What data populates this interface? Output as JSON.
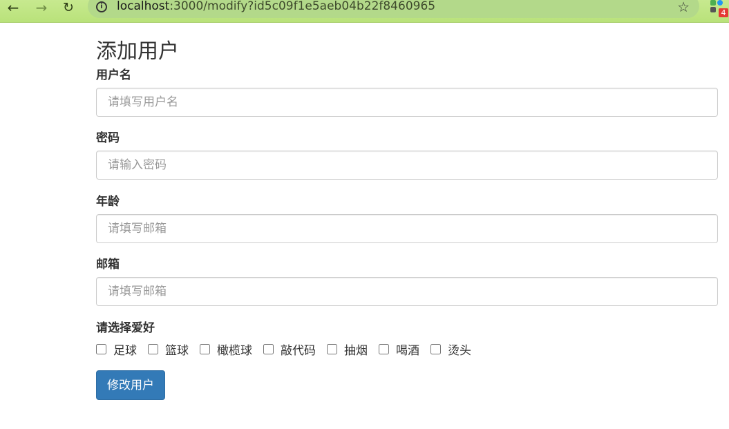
{
  "browser": {
    "url_host": "localhost",
    "url_rest": ":3000/modify?id5c09f1e5aeb04b22f8460965",
    "extension_badge": "4",
    "back_glyph": "←",
    "forward_glyph": "→",
    "reload_glyph": "↻",
    "star_glyph": "☆",
    "info_glyph": "i"
  },
  "page": {
    "title": "添加用户"
  },
  "form": {
    "username": {
      "label": "用户名",
      "placeholder": "请填写用户名",
      "value": ""
    },
    "password": {
      "label": "密码",
      "placeholder": "请输入密码",
      "value": ""
    },
    "age": {
      "label": "年龄",
      "placeholder": "请填写邮箱",
      "value": ""
    },
    "email": {
      "label": "邮箱",
      "placeholder": "请填写邮箱",
      "value": ""
    },
    "hobbies_label": "请选择爱好",
    "hobbies": [
      {
        "label": "足球",
        "checked": false
      },
      {
        "label": "篮球",
        "checked": false
      },
      {
        "label": "橄榄球",
        "checked": false
      },
      {
        "label": "敲代码",
        "checked": false
      },
      {
        "label": "抽烟",
        "checked": false
      },
      {
        "label": "喝酒",
        "checked": false
      },
      {
        "label": "烫头",
        "checked": false
      }
    ],
    "submit_label": "修改用户"
  },
  "colors": {
    "browser_bar": "#b9e27a",
    "primary_button": "#337ab7",
    "badge": "#e53935"
  }
}
